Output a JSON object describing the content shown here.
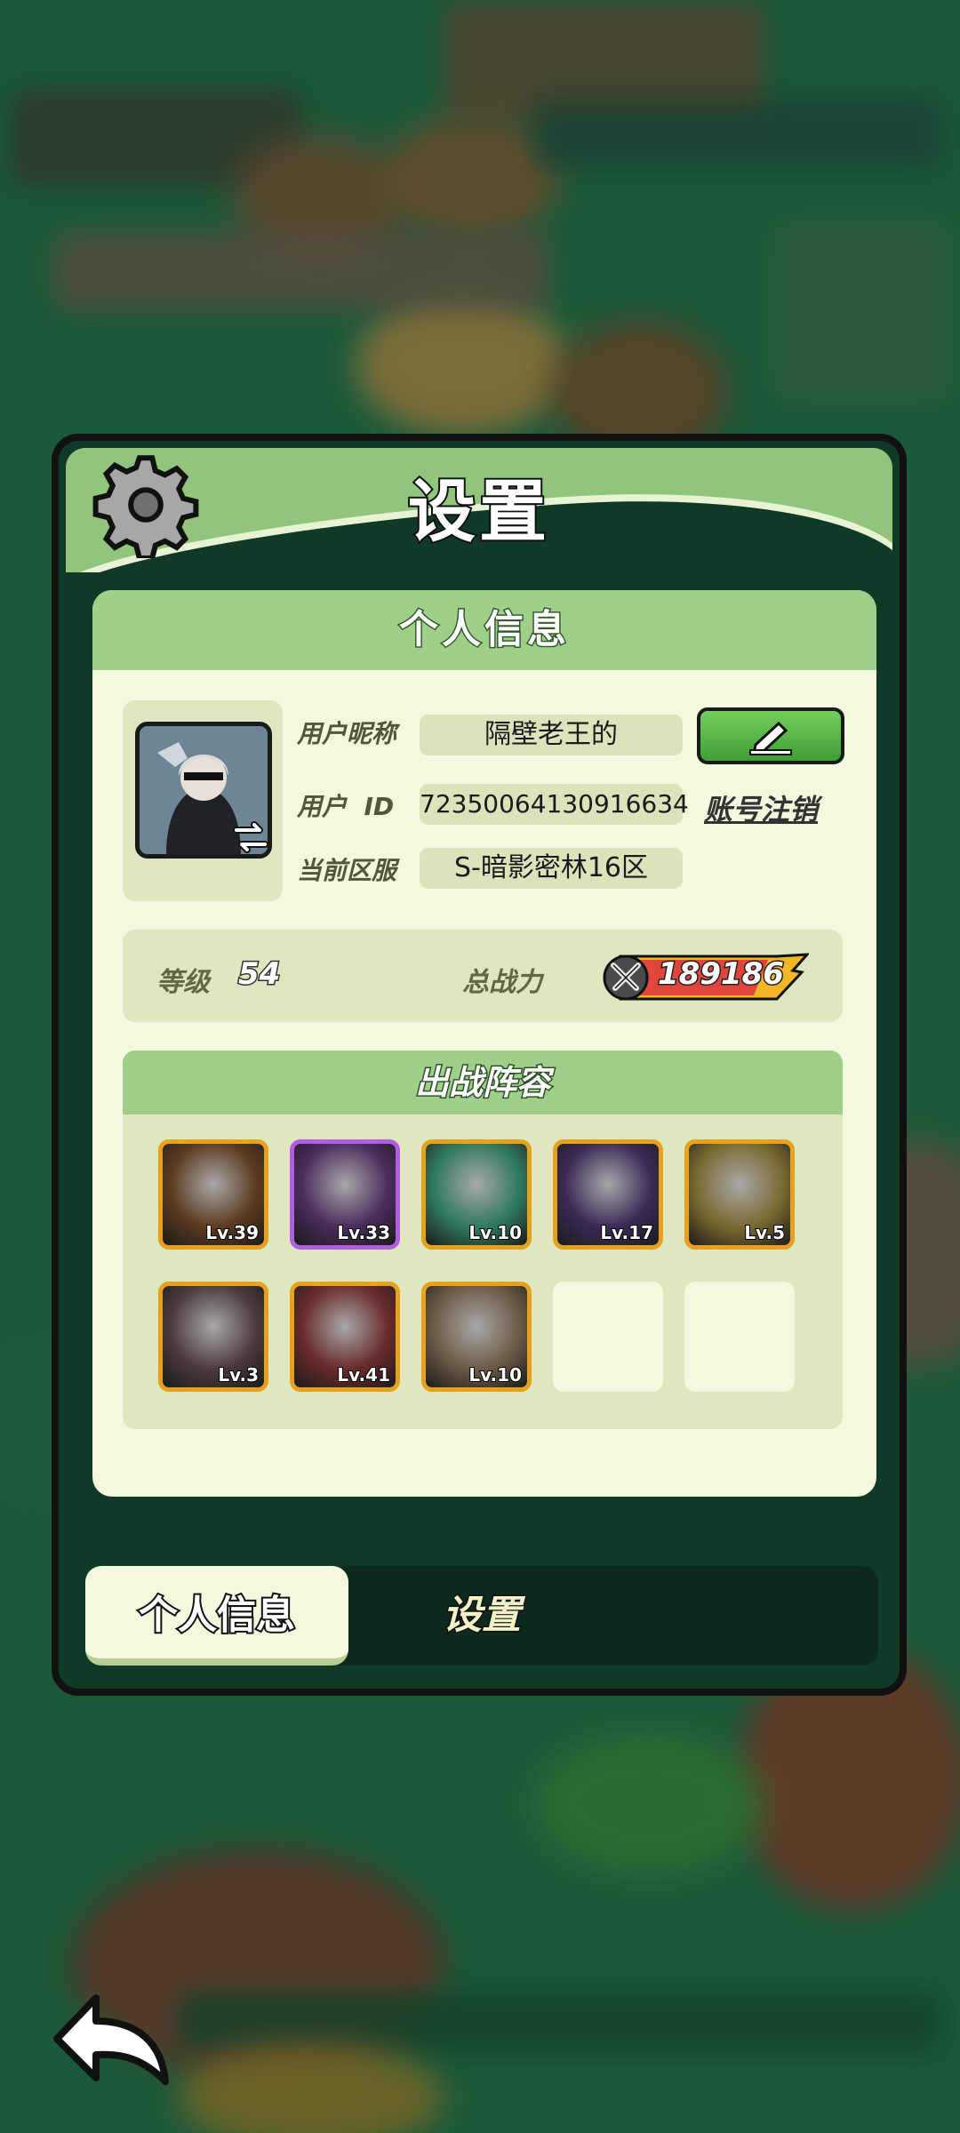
{
  "dialog": {
    "title": "设置",
    "panel_title": "个人信息"
  },
  "profile": {
    "nickname_label": "用户昵称",
    "nickname": "隔壁老王的",
    "id_label": "用户  ID",
    "id_value": "72350064130916634",
    "cancel_account": "账号注销",
    "server_label": "当前区服",
    "server_value": "S-暗影密林16区"
  },
  "stats": {
    "level_label": "等级",
    "level_value": "54",
    "power_label": "总战力",
    "power_value": "189186"
  },
  "lineup": {
    "title": "出战阵容",
    "heroes": [
      {
        "level": "Lv.39",
        "rarity": "orange",
        "color": "#5b3a1e"
      },
      {
        "level": "Lv.33",
        "rarity": "purple",
        "color": "#4a2c5c"
      },
      {
        "level": "Lv.10",
        "rarity": "orange",
        "color": "#2f7a5a"
      },
      {
        "level": "Lv.17",
        "rarity": "orange",
        "color": "#3a2a55"
      },
      {
        "level": "Lv.5",
        "rarity": "orange",
        "color": "#7a6a30"
      },
      {
        "level": "Lv.3",
        "rarity": "orange",
        "color": "#4a3a3a"
      },
      {
        "level": "Lv.41",
        "rarity": "orange",
        "color": "#6a2a2a"
      },
      {
        "level": "Lv.10",
        "rarity": "orange",
        "color": "#6b5a44"
      }
    ]
  },
  "tabs": {
    "personal": "个人信息",
    "settings": "设置"
  },
  "colors": {
    "accent_green": "#9fd08a",
    "panel_bg": "#f3f9dc",
    "dialog_bg": "#0f3a26"
  }
}
